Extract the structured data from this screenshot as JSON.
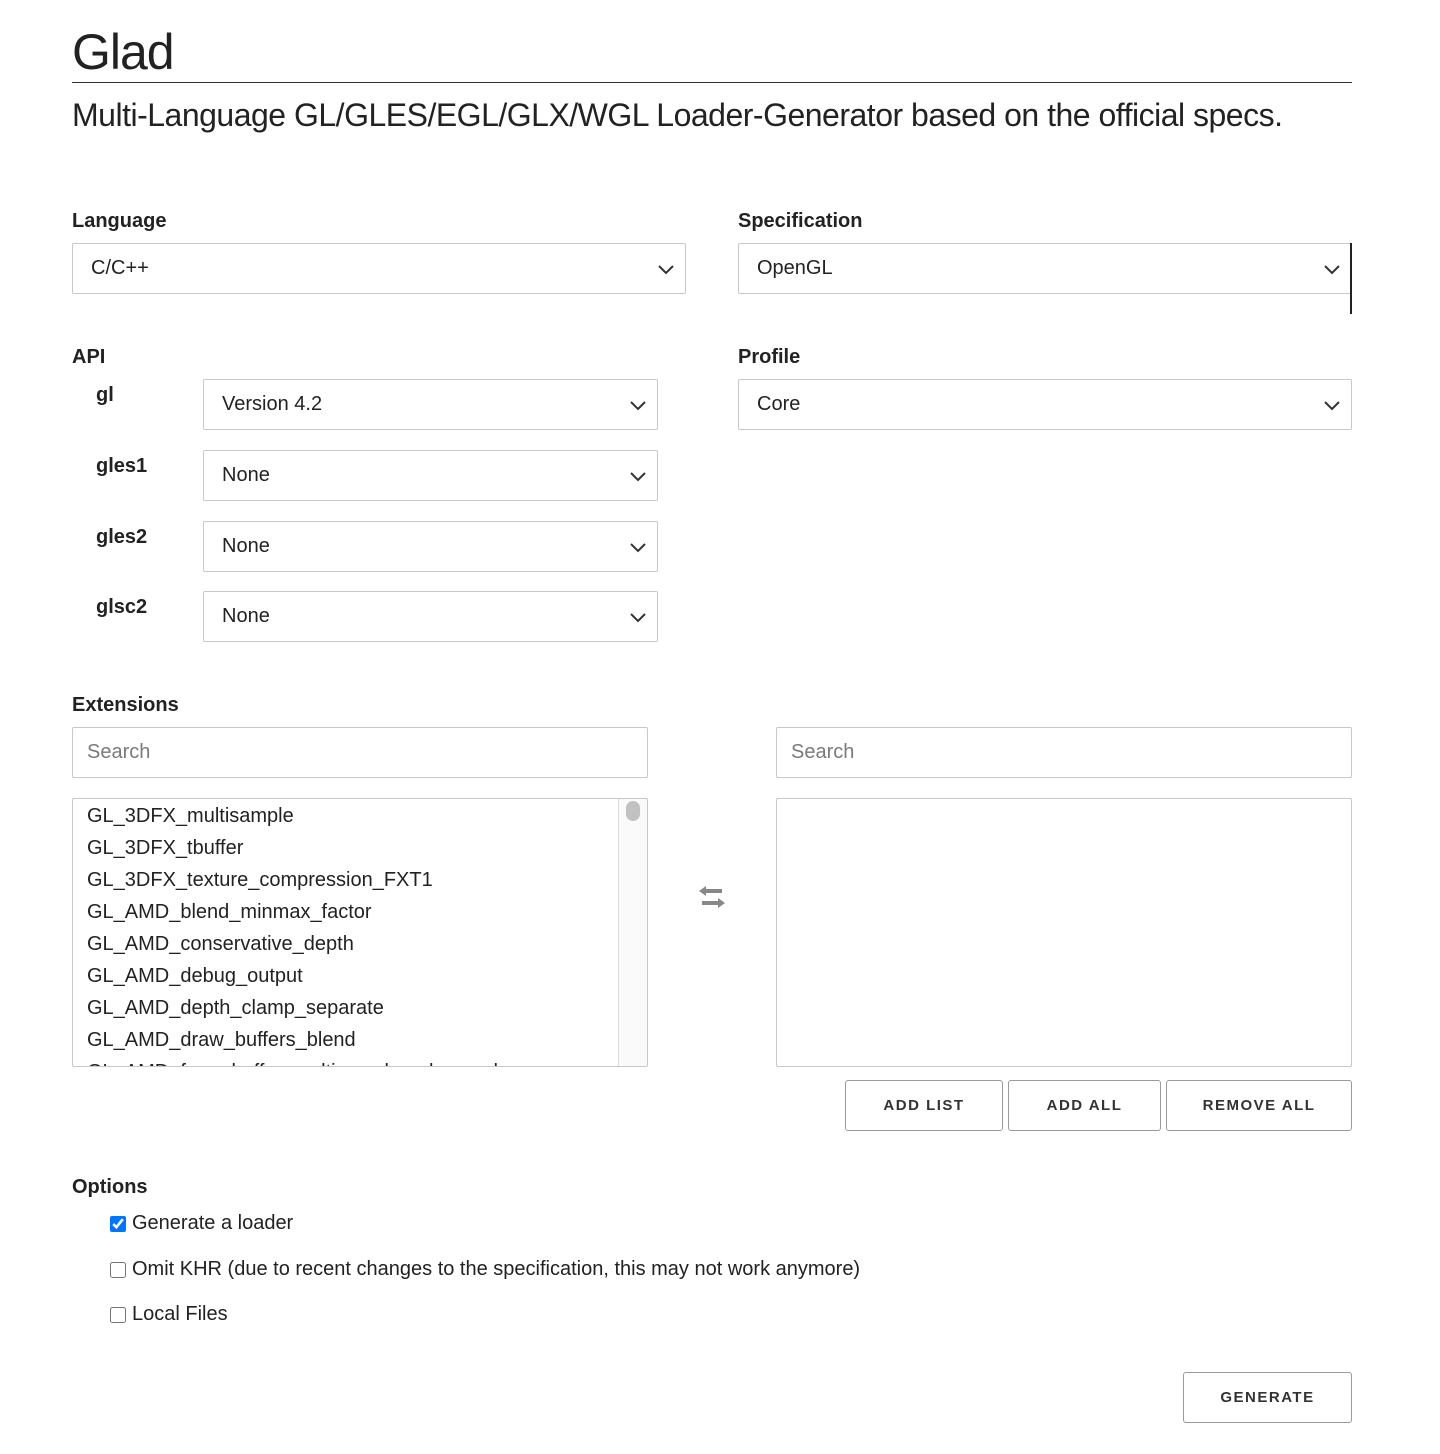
{
  "header": {
    "title": "Glad",
    "subtitle": "Multi-Language GL/GLES/EGL/GLX/WGL Loader-Generator based on the official specs."
  },
  "language": {
    "label": "Language",
    "value": "C/C++"
  },
  "specification": {
    "label": "Specification",
    "value": "OpenGL"
  },
  "api": {
    "label": "API",
    "rows": [
      {
        "name": "gl",
        "value": "Version 4.2"
      },
      {
        "name": "gles1",
        "value": "None"
      },
      {
        "name": "gles2",
        "value": "None"
      },
      {
        "name": "glsc2",
        "value": "None"
      }
    ]
  },
  "profile": {
    "label": "Profile",
    "value": "Core"
  },
  "extensions": {
    "label": "Extensions",
    "left_search_placeholder": "Search",
    "right_search_placeholder": "Search",
    "available": [
      "GL_3DFX_multisample",
      "GL_3DFX_tbuffer",
      "GL_3DFX_texture_compression_FXT1",
      "GL_AMD_blend_minmax_factor",
      "GL_AMD_conservative_depth",
      "GL_AMD_debug_output",
      "GL_AMD_depth_clamp_separate",
      "GL_AMD_draw_buffers_blend",
      "GL_AMD_framebuffer_multisample_advanced"
    ],
    "selected": [],
    "buttons": {
      "add_list": "ADD LIST",
      "add_all": "ADD ALL",
      "remove_all": "REMOVE ALL"
    },
    "transfer_icon": "swap-arrows-icon"
  },
  "options": {
    "label": "Options",
    "items": [
      {
        "label": "Generate a loader",
        "checked": true
      },
      {
        "label": "Omit KHR (due to recent changes to the specification, this may not work anymore)",
        "checked": false
      },
      {
        "label": "Local Files",
        "checked": false
      }
    ]
  },
  "generate_label": "GENERATE"
}
